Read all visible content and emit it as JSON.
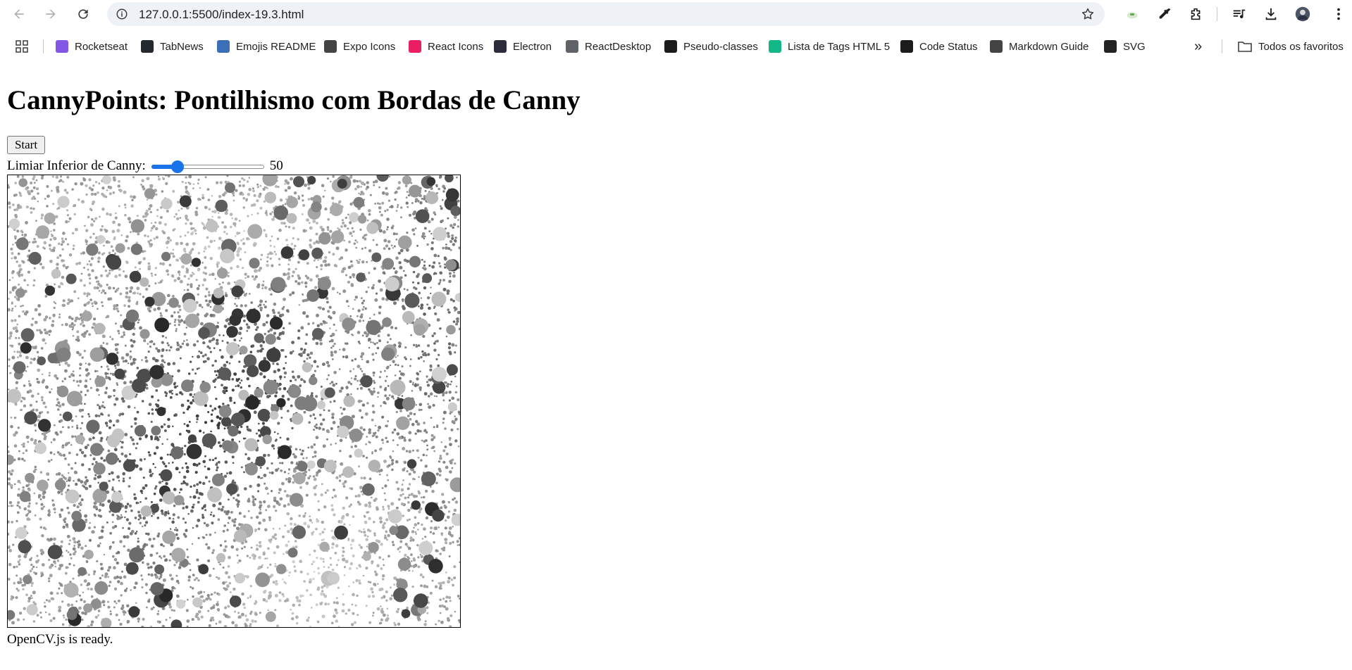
{
  "browser": {
    "url": "127.0.0.1:5500/index-19.3.html"
  },
  "bookmarks": {
    "items": [
      {
        "label": "Rocketseat",
        "icon": "rocketseat-icon",
        "color": "#8257e5"
      },
      {
        "label": "TabNews",
        "icon": "tabnews-icon",
        "color": "#24292f"
      },
      {
        "label": "Emojis README",
        "icon": "fx-icon",
        "color": "#3b6fb6"
      },
      {
        "label": "Expo Icons",
        "icon": "expo-icon",
        "color": "#444444"
      },
      {
        "label": "React Icons",
        "icon": "react-icon",
        "color": "#e91e63"
      },
      {
        "label": "Electron",
        "icon": "electron-icon",
        "color": "#2b2e3a"
      },
      {
        "label": "ReactDesktop",
        "icon": "globe-icon",
        "color": "#5f6368"
      },
      {
        "label": "Pseudo-classes",
        "icon": "mdn-icon",
        "color": "#1b1b1b"
      },
      {
        "label": "Lista de Tags HTML 5",
        "icon": "hexagon-icon",
        "color": "#12b886"
      },
      {
        "label": "Code Status",
        "icon": "mdn-icon",
        "color": "#1b1b1b"
      },
      {
        "label": "Markdown Guide",
        "icon": "markdown-icon",
        "color": "#444444"
      },
      {
        "label": "SVG",
        "icon": "svg-icon",
        "color": "#222222"
      }
    ],
    "overflow": "»",
    "all_bookmarks": "Todos os favoritos"
  },
  "page": {
    "title": "CannyPoints: Pontilhismo com Bordas de Canny",
    "start_label": "Start",
    "slider_label": "Limiar Inferior de Canny:",
    "slider_value": "50",
    "slider_fraction": 0.2,
    "status": "OpenCV.js is ready."
  },
  "colors": {
    "accent": "#1a73e8",
    "omnibox": "#eef1f6"
  }
}
